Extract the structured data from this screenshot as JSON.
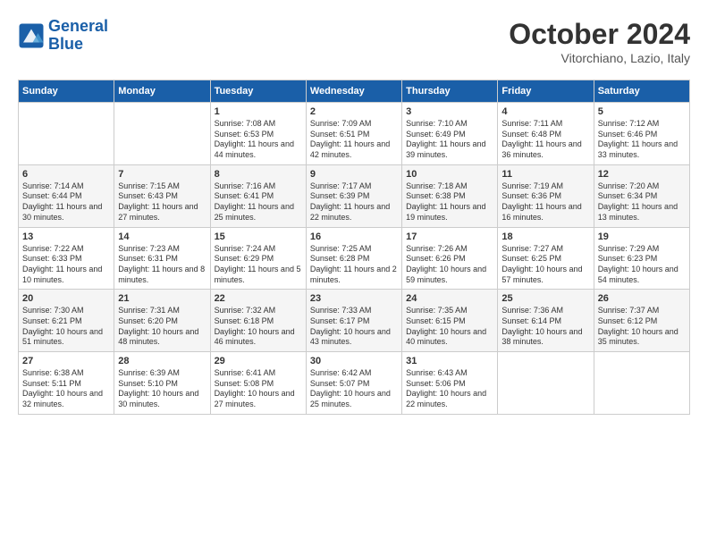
{
  "logo": {
    "line1": "General",
    "line2": "Blue"
  },
  "title": "October 2024",
  "location": "Vitorchiano, Lazio, Italy",
  "weekdays": [
    "Sunday",
    "Monday",
    "Tuesday",
    "Wednesday",
    "Thursday",
    "Friday",
    "Saturday"
  ],
  "weeks": [
    [
      null,
      null,
      {
        "day": "1",
        "sunrise": "7:08 AM",
        "sunset": "6:53 PM",
        "daylight": "11 hours and 44 minutes."
      },
      {
        "day": "2",
        "sunrise": "7:09 AM",
        "sunset": "6:51 PM",
        "daylight": "11 hours and 42 minutes."
      },
      {
        "day": "3",
        "sunrise": "7:10 AM",
        "sunset": "6:49 PM",
        "daylight": "11 hours and 39 minutes."
      },
      {
        "day": "4",
        "sunrise": "7:11 AM",
        "sunset": "6:48 PM",
        "daylight": "11 hours and 36 minutes."
      },
      {
        "day": "5",
        "sunrise": "7:12 AM",
        "sunset": "6:46 PM",
        "daylight": "11 hours and 33 minutes."
      }
    ],
    [
      {
        "day": "6",
        "sunrise": "7:14 AM",
        "sunset": "6:44 PM",
        "daylight": "11 hours and 30 minutes."
      },
      {
        "day": "7",
        "sunrise": "7:15 AM",
        "sunset": "6:43 PM",
        "daylight": "11 hours and 27 minutes."
      },
      {
        "day": "8",
        "sunrise": "7:16 AM",
        "sunset": "6:41 PM",
        "daylight": "11 hours and 25 minutes."
      },
      {
        "day": "9",
        "sunrise": "7:17 AM",
        "sunset": "6:39 PM",
        "daylight": "11 hours and 22 minutes."
      },
      {
        "day": "10",
        "sunrise": "7:18 AM",
        "sunset": "6:38 PM",
        "daylight": "11 hours and 19 minutes."
      },
      {
        "day": "11",
        "sunrise": "7:19 AM",
        "sunset": "6:36 PM",
        "daylight": "11 hours and 16 minutes."
      },
      {
        "day": "12",
        "sunrise": "7:20 AM",
        "sunset": "6:34 PM",
        "daylight": "11 hours and 13 minutes."
      }
    ],
    [
      {
        "day": "13",
        "sunrise": "7:22 AM",
        "sunset": "6:33 PM",
        "daylight": "11 hours and 10 minutes."
      },
      {
        "day": "14",
        "sunrise": "7:23 AM",
        "sunset": "6:31 PM",
        "daylight": "11 hours and 8 minutes."
      },
      {
        "day": "15",
        "sunrise": "7:24 AM",
        "sunset": "6:29 PM",
        "daylight": "11 hours and 5 minutes."
      },
      {
        "day": "16",
        "sunrise": "7:25 AM",
        "sunset": "6:28 PM",
        "daylight": "11 hours and 2 minutes."
      },
      {
        "day": "17",
        "sunrise": "7:26 AM",
        "sunset": "6:26 PM",
        "daylight": "10 hours and 59 minutes."
      },
      {
        "day": "18",
        "sunrise": "7:27 AM",
        "sunset": "6:25 PM",
        "daylight": "10 hours and 57 minutes."
      },
      {
        "day": "19",
        "sunrise": "7:29 AM",
        "sunset": "6:23 PM",
        "daylight": "10 hours and 54 minutes."
      }
    ],
    [
      {
        "day": "20",
        "sunrise": "7:30 AM",
        "sunset": "6:21 PM",
        "daylight": "10 hours and 51 minutes."
      },
      {
        "day": "21",
        "sunrise": "7:31 AM",
        "sunset": "6:20 PM",
        "daylight": "10 hours and 48 minutes."
      },
      {
        "day": "22",
        "sunrise": "7:32 AM",
        "sunset": "6:18 PM",
        "daylight": "10 hours and 46 minutes."
      },
      {
        "day": "23",
        "sunrise": "7:33 AM",
        "sunset": "6:17 PM",
        "daylight": "10 hours and 43 minutes."
      },
      {
        "day": "24",
        "sunrise": "7:35 AM",
        "sunset": "6:15 PM",
        "daylight": "10 hours and 40 minutes."
      },
      {
        "day": "25",
        "sunrise": "7:36 AM",
        "sunset": "6:14 PM",
        "daylight": "10 hours and 38 minutes."
      },
      {
        "day": "26",
        "sunrise": "7:37 AM",
        "sunset": "6:12 PM",
        "daylight": "10 hours and 35 minutes."
      }
    ],
    [
      {
        "day": "27",
        "sunrise": "6:38 AM",
        "sunset": "5:11 PM",
        "daylight": "10 hours and 32 minutes."
      },
      {
        "day": "28",
        "sunrise": "6:39 AM",
        "sunset": "5:10 PM",
        "daylight": "10 hours and 30 minutes."
      },
      {
        "day": "29",
        "sunrise": "6:41 AM",
        "sunset": "5:08 PM",
        "daylight": "10 hours and 27 minutes."
      },
      {
        "day": "30",
        "sunrise": "6:42 AM",
        "sunset": "5:07 PM",
        "daylight": "10 hours and 25 minutes."
      },
      {
        "day": "31",
        "sunrise": "6:43 AM",
        "sunset": "5:06 PM",
        "daylight": "10 hours and 22 minutes."
      },
      null,
      null
    ]
  ]
}
